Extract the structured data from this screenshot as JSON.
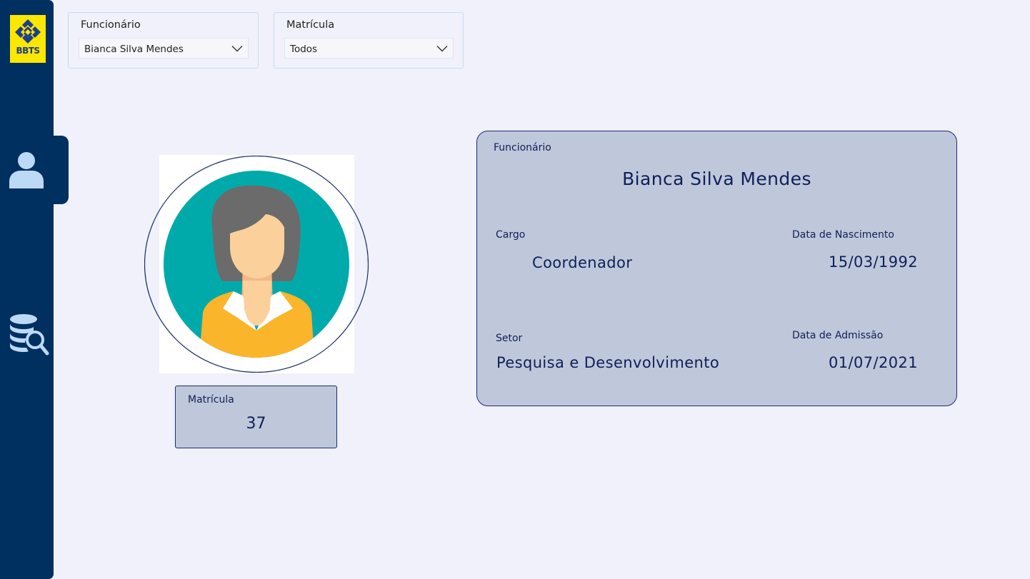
{
  "sidebar": {
    "logo_text": "BBTS",
    "brand_colors": {
      "navy": "#003060",
      "yellow": "#fce700",
      "logo_blue": "#1d3d8f"
    },
    "nav": [
      {
        "icon": "user-icon",
        "active": true
      },
      {
        "icon": "database-search-icon",
        "active": false
      }
    ]
  },
  "filters": {
    "funcionario": {
      "title": "Funcionário",
      "selected": "Bianca Silva Mendes"
    },
    "matricula": {
      "title": "Matrícula",
      "selected": "Todos"
    }
  },
  "profile": {
    "avatar_icon": "female-avatar-icon",
    "matricula_label": "Matrícula",
    "matricula_value": "37"
  },
  "details": {
    "funcionario_label": "Funcionário",
    "name": "Bianca Silva Mendes",
    "cargo_label": "Cargo",
    "cargo": "Coordenador",
    "nascimento_label": "Data de Nascimento",
    "nascimento": "15/03/1992",
    "setor_label": "Setor",
    "setor": "Pesquisa e Desenvolvimento",
    "admissao_label": "Data de Admissão",
    "admissao": "01/07/2021"
  }
}
